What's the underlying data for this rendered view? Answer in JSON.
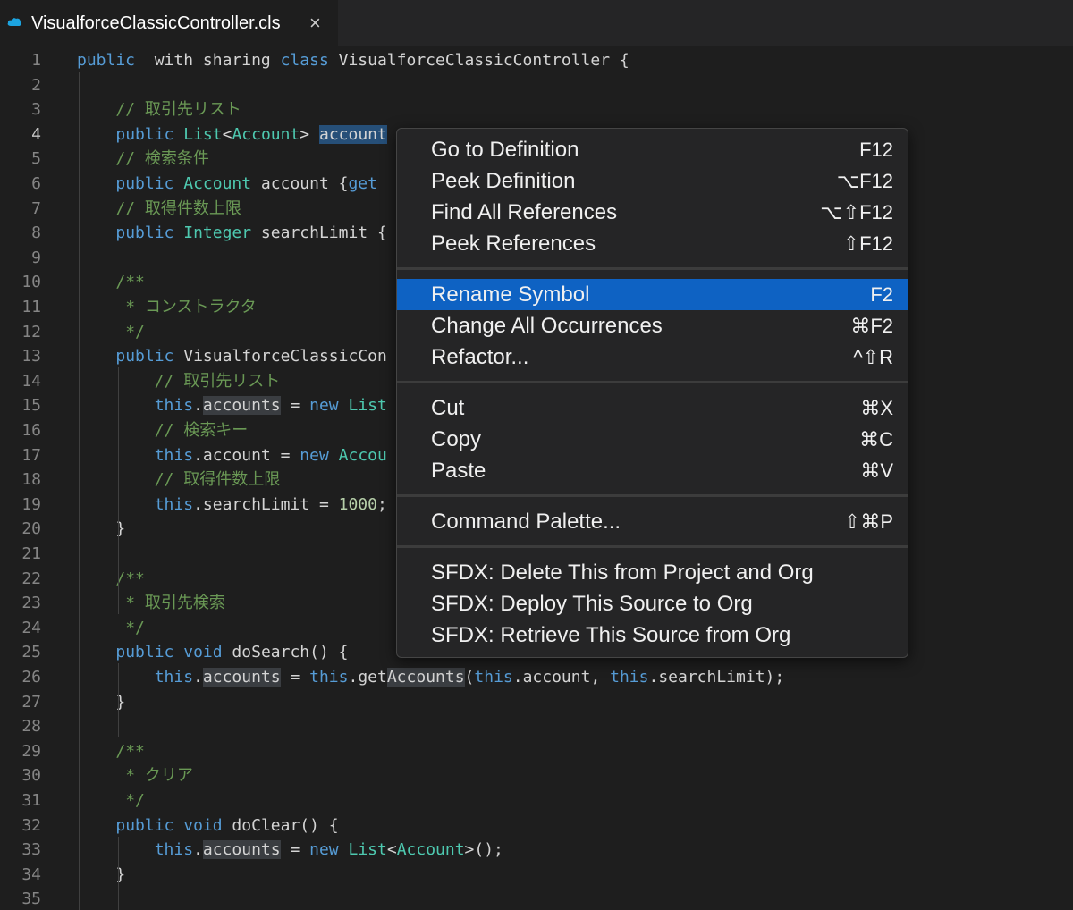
{
  "tab": {
    "title": "VisualforceClassicController.cls",
    "close": "×",
    "icon": "salesforce-cloud-icon"
  },
  "lines": [
    [
      [
        "kw",
        "public"
      ],
      [
        "",
        "  with sharing "
      ],
      [
        "kw",
        "class"
      ],
      [
        "",
        " VisualforceClassicController {"
      ]
    ],
    [],
    [
      [
        "",
        "    "
      ],
      [
        "cm",
        "// 取引先リスト"
      ]
    ],
    [
      [
        "",
        "    "
      ],
      [
        "kw",
        "public"
      ],
      [
        "",
        " "
      ],
      [
        "ty",
        "List"
      ],
      [
        "",
        "<"
      ],
      [
        "ty",
        "Account"
      ],
      [
        "",
        "> "
      ],
      [
        "sel",
        "account"
      ]
    ],
    [
      [
        "",
        "    "
      ],
      [
        "cm",
        "// 検索条件"
      ]
    ],
    [
      [
        "",
        "    "
      ],
      [
        "kw",
        "public"
      ],
      [
        "",
        " "
      ],
      [
        "ty",
        "Account"
      ],
      [
        "",
        " account {"
      ],
      [
        "kw",
        "get"
      ],
      [
        ";"
      ]
    ],
    [
      [
        "",
        "    "
      ],
      [
        "cm",
        "// 取得件数上限"
      ]
    ],
    [
      [
        "",
        "    "
      ],
      [
        "kw",
        "public"
      ],
      [
        "",
        " "
      ],
      [
        "ty",
        "Integer"
      ],
      [
        "",
        " searchLimit {"
      ]
    ],
    [],
    [
      [
        "",
        "    "
      ],
      [
        "cm",
        "/**"
      ]
    ],
    [
      [
        "",
        "     "
      ],
      [
        "cm",
        "* コンストラクタ"
      ]
    ],
    [
      [
        "",
        "     "
      ],
      [
        "cm",
        "*/"
      ]
    ],
    [
      [
        "",
        "    "
      ],
      [
        "kw",
        "public"
      ],
      [
        "",
        " VisualforceClassicCon"
      ]
    ],
    [
      [
        "",
        "        "
      ],
      [
        "cm",
        "// 取引先リスト"
      ]
    ],
    [
      [
        "",
        "        "
      ],
      [
        "kw",
        "this"
      ],
      [
        "",
        "."
      ],
      [
        "hl",
        "accounts"
      ],
      [
        "",
        " = "
      ],
      [
        "kw",
        "new"
      ],
      [
        "",
        " "
      ],
      [
        "ty",
        "List"
      ]
    ],
    [
      [
        "",
        "        "
      ],
      [
        "cm",
        "// 検索キー"
      ]
    ],
    [
      [
        "",
        "        "
      ],
      [
        "kw",
        "this"
      ],
      [
        "",
        ".account = "
      ],
      [
        "kw",
        "new"
      ],
      [
        "",
        " "
      ],
      [
        "ty",
        "Accou"
      ]
    ],
    [
      [
        "",
        "        "
      ],
      [
        "cm",
        "// 取得件数上限"
      ]
    ],
    [
      [
        "",
        "        "
      ],
      [
        "kw",
        "this"
      ],
      [
        "",
        ".searchLimit = "
      ],
      [
        "num",
        "1000"
      ],
      [
        "",
        ";"
      ]
    ],
    [
      [
        "",
        "    }"
      ]
    ],
    [],
    [
      [
        "",
        "    "
      ],
      [
        "cm",
        "/**"
      ]
    ],
    [
      [
        "",
        "     "
      ],
      [
        "cm",
        "* 取引先検索"
      ]
    ],
    [
      [
        "",
        "     "
      ],
      [
        "cm",
        "*/"
      ]
    ],
    [
      [
        "",
        "    "
      ],
      [
        "kw",
        "public"
      ],
      [
        "",
        " "
      ],
      [
        "kw",
        "void"
      ],
      [
        "",
        " doSearch() {"
      ]
    ],
    [
      [
        "",
        "        "
      ],
      [
        "kw",
        "this"
      ],
      [
        "",
        "."
      ],
      [
        "hl",
        "accounts"
      ],
      [
        "",
        " = "
      ],
      [
        "kw",
        "this"
      ],
      [
        "",
        ".get"
      ],
      [
        "hl",
        "Accounts"
      ],
      [
        "",
        "("
      ],
      [
        "kw",
        "this"
      ],
      [
        "",
        ".account, "
      ],
      [
        "kw",
        "this"
      ],
      [
        "",
        ".searchLimit);"
      ]
    ],
    [
      [
        "",
        "    }"
      ]
    ],
    [],
    [
      [
        "",
        "    "
      ],
      [
        "cm",
        "/**"
      ]
    ],
    [
      [
        "",
        "     "
      ],
      [
        "cm",
        "* クリア"
      ]
    ],
    [
      [
        "",
        "     "
      ],
      [
        "cm",
        "*/"
      ]
    ],
    [
      [
        "",
        "    "
      ],
      [
        "kw",
        "public"
      ],
      [
        "",
        " "
      ],
      [
        "kw",
        "void"
      ],
      [
        "",
        " doClear() {"
      ]
    ],
    [
      [
        "",
        "        "
      ],
      [
        "kw",
        "this"
      ],
      [
        "",
        "."
      ],
      [
        "hl",
        "accounts"
      ],
      [
        "",
        " = "
      ],
      [
        "kw",
        "new"
      ],
      [
        "",
        " "
      ],
      [
        "ty",
        "List"
      ],
      [
        "",
        "<"
      ],
      [
        "ty",
        "Account"
      ],
      [
        "",
        ">();"
      ]
    ],
    [
      [
        "",
        "    }"
      ]
    ],
    []
  ],
  "line_numbers": [
    "1",
    "2",
    "3",
    "4",
    "5",
    "6",
    "7",
    "8",
    "9",
    "10",
    "11",
    "12",
    "13",
    "14",
    "15",
    "16",
    "17",
    "18",
    "19",
    "20",
    "21",
    "22",
    "23",
    "24",
    "25",
    "26",
    "27",
    "28",
    "29",
    "30",
    "31",
    "32",
    "33",
    "34",
    "35"
  ],
  "active_line": "4",
  "menu": {
    "groups": [
      [
        {
          "label": "Go to Definition",
          "key": "F12"
        },
        {
          "label": "Peek Definition",
          "key": "⌥F12"
        },
        {
          "label": "Find All References",
          "key": "⌥⇧F12"
        },
        {
          "label": "Peek References",
          "key": "⇧F12"
        }
      ],
      [
        {
          "label": "Rename Symbol",
          "key": "F2",
          "active": true
        },
        {
          "label": "Change All Occurrences",
          "key": "⌘F2"
        },
        {
          "label": "Refactor...",
          "key": "^⇧R"
        }
      ],
      [
        {
          "label": "Cut",
          "key": "⌘X"
        },
        {
          "label": "Copy",
          "key": "⌘C"
        },
        {
          "label": "Paste",
          "key": "⌘V"
        }
      ],
      [
        {
          "label": "Command Palette...",
          "key": "⇧⌘P"
        }
      ],
      [
        {
          "label": "SFDX: Delete This from Project and Org",
          "key": ""
        },
        {
          "label": "SFDX: Deploy This Source to Org",
          "key": ""
        },
        {
          "label": "SFDX: Retrieve This Source from Org",
          "key": ""
        }
      ]
    ]
  },
  "colors": {
    "accent": "#0e62c3",
    "background": "#1e1e1e",
    "keyword": "#569cd6",
    "type": "#4ec9b0",
    "comment": "#6a9955"
  }
}
